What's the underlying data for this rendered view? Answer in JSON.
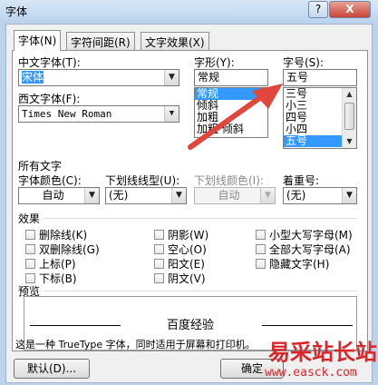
{
  "window": {
    "title": "字体",
    "help_label": "?",
    "close_label": "X"
  },
  "tabs": [
    {
      "label": "字体(N)",
      "active": true
    },
    {
      "label": "字符间距(R)",
      "active": false
    },
    {
      "label": "文字效果(X)",
      "active": false
    }
  ],
  "font": {
    "cjk_label": "中文字体(T):",
    "cjk_value": "宋体",
    "western_label": "西文字体(F):",
    "western_value": "Times New Roman",
    "style_label": "字形(Y):",
    "style_value": "常规",
    "style_options": [
      "常规",
      "倾斜",
      "加粗",
      "加粗 倾斜"
    ],
    "size_label": "字号(S):",
    "size_value": "五号",
    "size_options": [
      "三号",
      "小三",
      "四号",
      "小四",
      "五号"
    ]
  },
  "all_text": {
    "heading": "所有文字",
    "color_label": "字体颜色(C):",
    "color_value": "自动",
    "underline_label": "下划线线型(U):",
    "underline_value": "(无)",
    "underline_color_label": "下划线颜色(I):",
    "underline_color_value": "自动",
    "emphasis_label": "着重号:",
    "emphasis_value": "(无)"
  },
  "effects": {
    "heading": "效果",
    "items": [
      "删除线(K)",
      "双删除线(G)",
      "上标(P)",
      "下标(B)",
      "阴影(W)",
      "空心(O)",
      "阳文(E)",
      "阴文(V)",
      "小型大写字母(M)",
      "全部大写字母(A)",
      "隐藏文字(H)"
    ]
  },
  "preview": {
    "heading": "预览",
    "sample": "百度经验"
  },
  "info_text": "这是一种 TrueType 字体，同时适用于屏幕和打印机。",
  "buttons": {
    "default_label": "默认(D)...",
    "ok_label": "确定"
  },
  "watermark": {
    "text": "易采站长站",
    "url": "www.easck.com"
  },
  "colors": {
    "selection": "#3399ff",
    "arrow": "#e0463c",
    "watermark": "#d9262b"
  }
}
